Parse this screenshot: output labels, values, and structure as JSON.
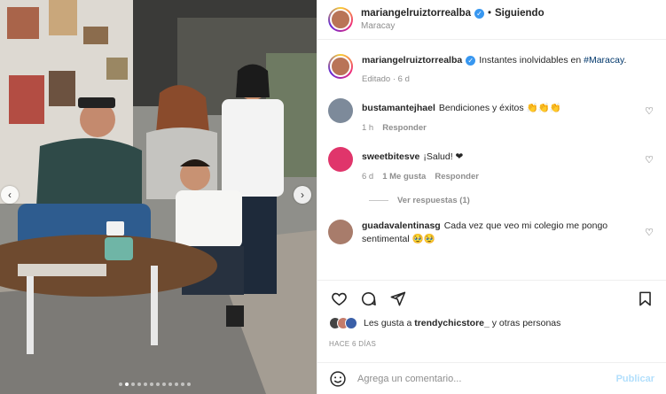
{
  "header": {
    "username": "mariangelruiztorrealba",
    "separator": "•",
    "follow_label": "Siguiendo",
    "location": "Maracay"
  },
  "caption": {
    "username": "mariangelruiztorrealba",
    "text": "Instantes inolvidables en",
    "hashtag": "#Maracay",
    "suffix": ".",
    "meta": "Editado · 6 d"
  },
  "comments": [
    {
      "username": "bustamantejhael",
      "text": "Bendiciones y éxitos 👏👏👏",
      "time": "1 h",
      "reply": "Responder"
    },
    {
      "username": "sweetbitesve",
      "text": "¡Salud! ❤",
      "time": "6 d",
      "likes": "1 Me gusta",
      "reply": "Responder",
      "view_replies": "Ver respuestas (1)"
    },
    {
      "username": "guadavalentinasg",
      "text": "Cada vez que veo mi colegio me pongo sentimental 🥹🥹"
    }
  ],
  "likes": {
    "prefix": "Les gusta a",
    "user": "trendychicstore_",
    "suffix": "y otras personas"
  },
  "time_ago": "HACE 6 DÍAS",
  "add_comment": {
    "placeholder": "Agrega un comentario...",
    "publish_label": "Publicar"
  },
  "icons": {
    "like": "heart-icon",
    "comment": "comment-icon",
    "share": "share-icon",
    "save": "bookmark-icon",
    "emoji": "emoji-icon"
  },
  "colors": {
    "verified": "#3897f0",
    "hashtag": "#00376b",
    "publish": "#b2dffc",
    "meta": "#8e8e8e"
  }
}
